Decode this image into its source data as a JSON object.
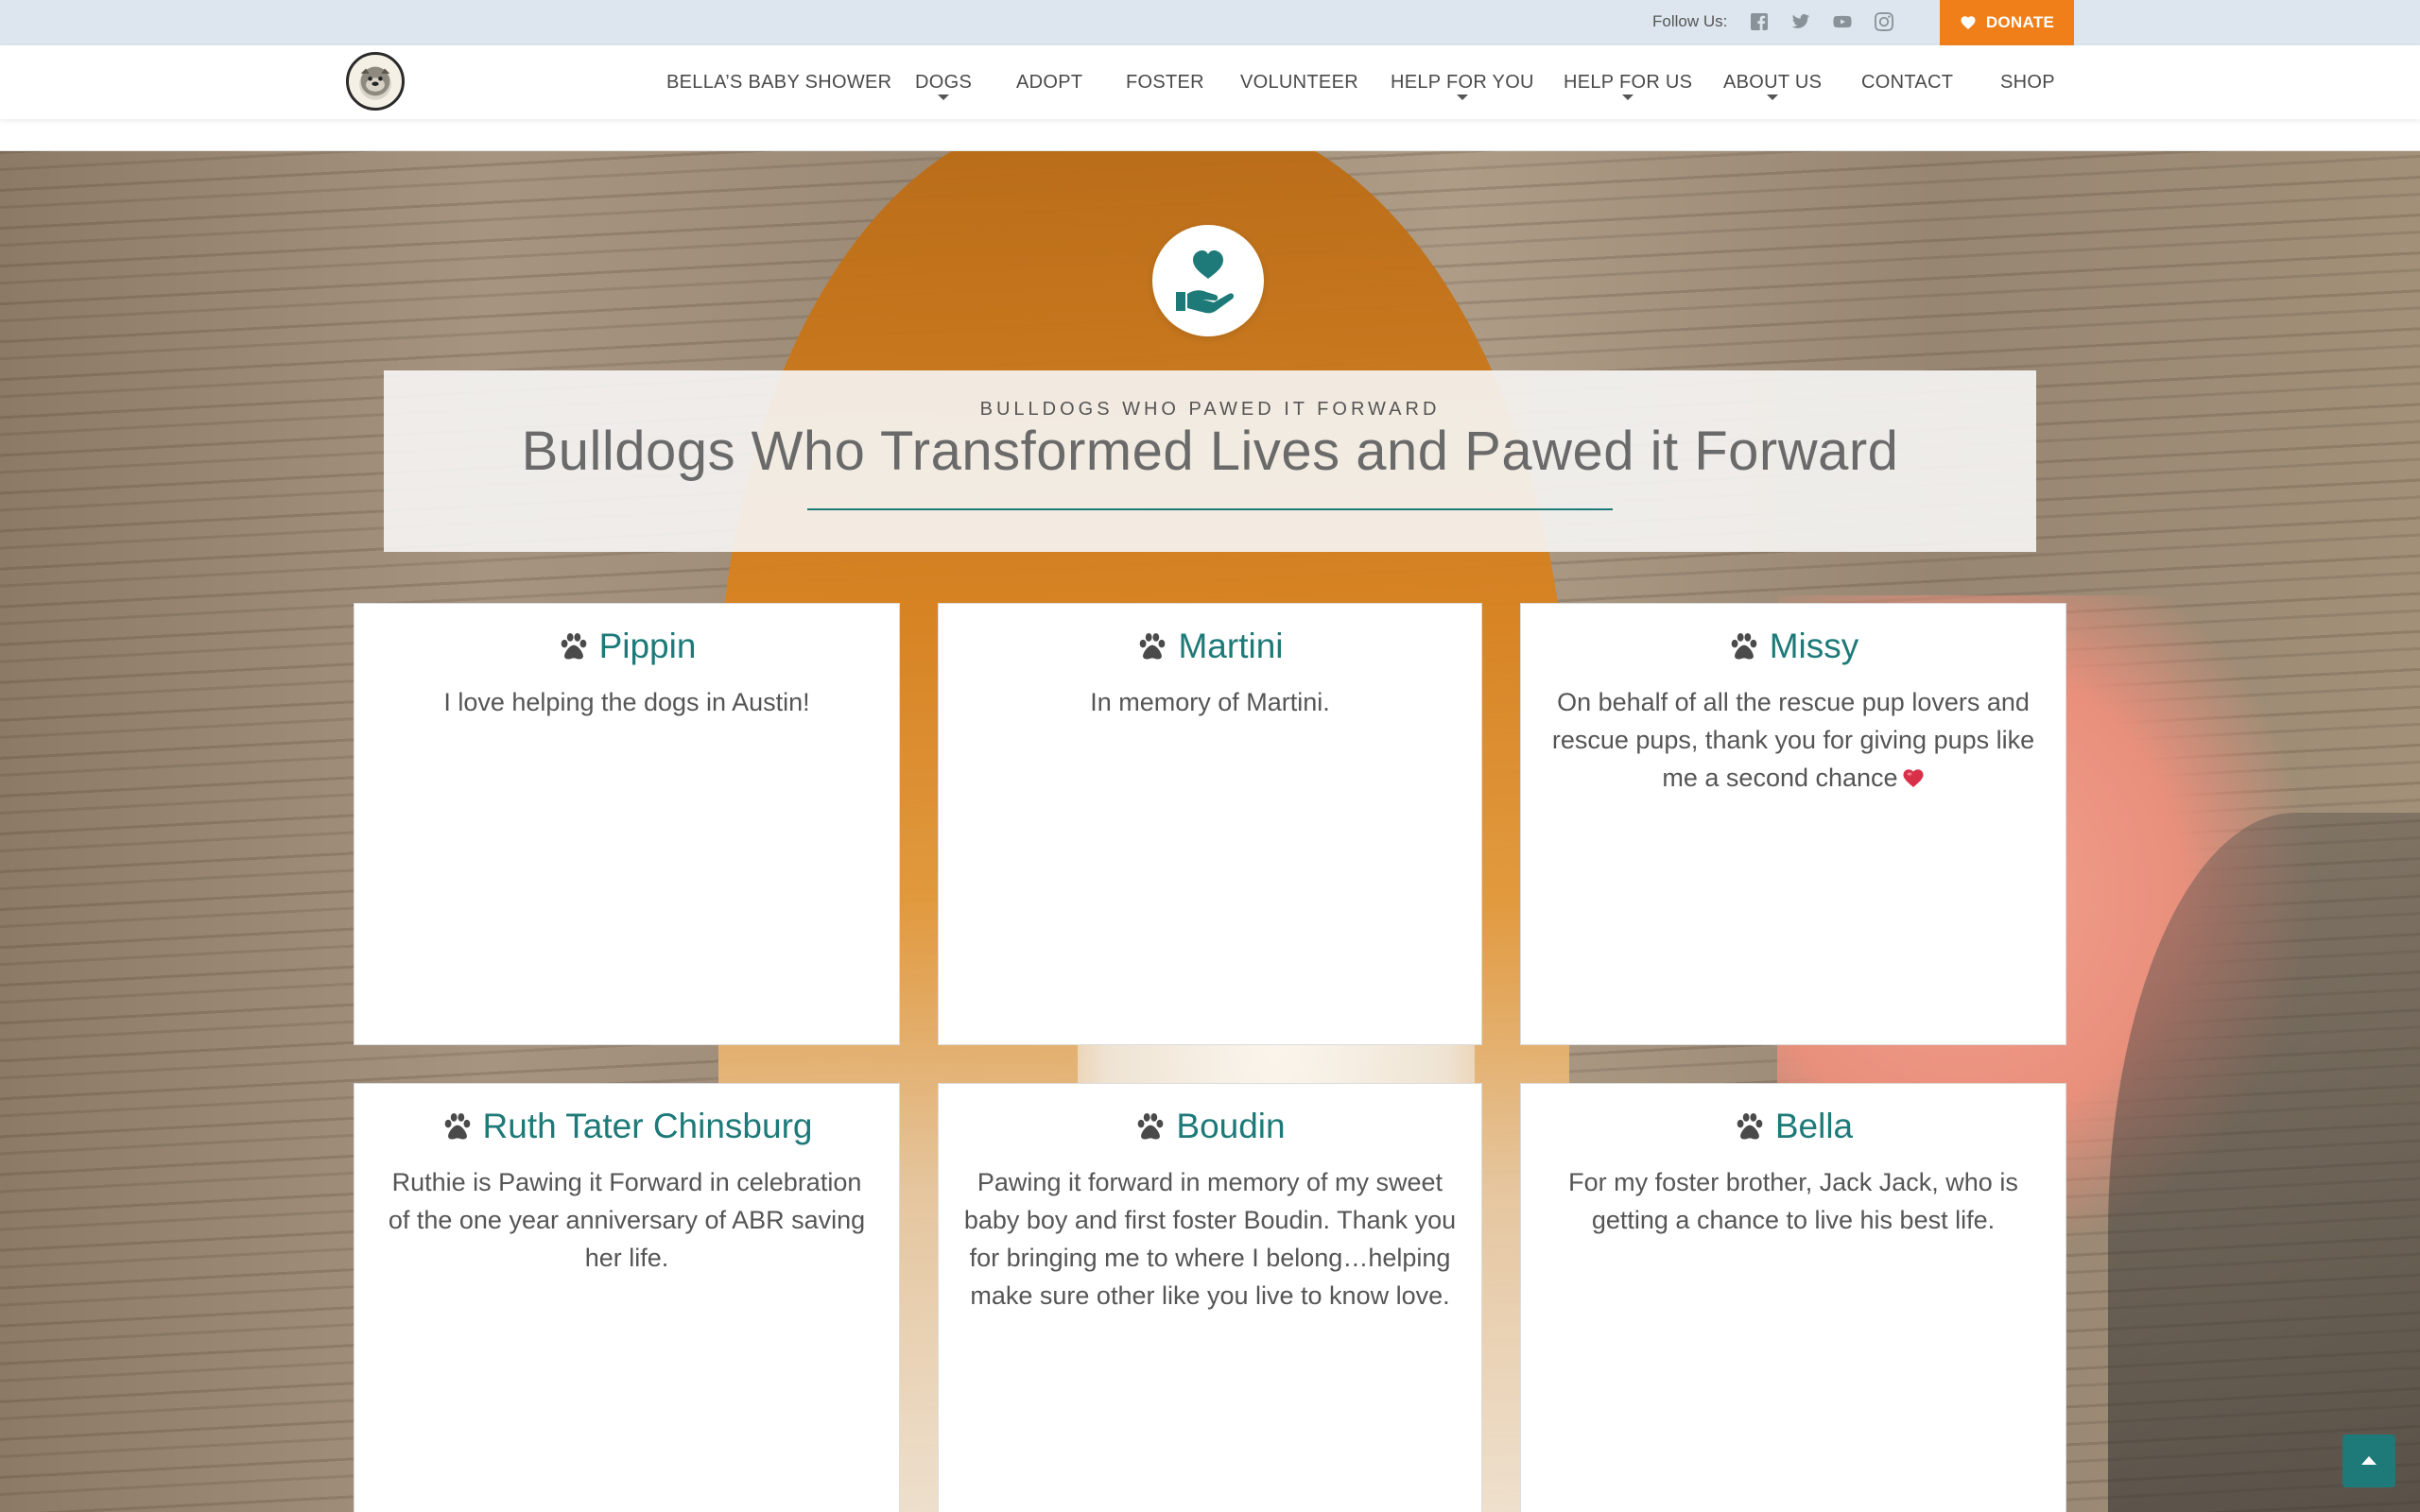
{
  "topbar": {
    "follow_label": "Follow Us:",
    "social_icons": [
      "facebook-icon",
      "twitter-icon",
      "youtube-icon",
      "instagram-icon"
    ],
    "donate_label": "DONATE",
    "donate_color": "#f07f1a"
  },
  "nav": {
    "items": [
      {
        "label": "BELLA’S BABY SHOWER"
      },
      {
        "label": "DOGS",
        "dropdown": true
      },
      {
        "label": "ADOPT"
      },
      {
        "label": "FOSTER"
      },
      {
        "label": "VOLUNTEER"
      },
      {
        "label": "HELP FOR YOU",
        "dropdown": true
      },
      {
        "label": "HELP FOR US",
        "dropdown": true
      },
      {
        "label": "ABOUT US",
        "dropdown": true
      },
      {
        "label": "CONTACT"
      },
      {
        "label": "SHOP"
      }
    ]
  },
  "hero": {
    "kicker": "BULLDOGS WHO PAWED IT FORWARD",
    "title": "Bulldogs Who Transformed Lives and Pawed it Forward",
    "accent_color": "#1d7a78"
  },
  "cards": [
    {
      "name": "Pippin",
      "text": "I love helping the dogs in Austin!"
    },
    {
      "name": "Martini",
      "text": "In memory of Martini."
    },
    {
      "name": "Missy",
      "text": "On behalf of all the rescue pup lovers and rescue pups, thank you for giving pups like me a second chance",
      "emoji": "heart"
    },
    {
      "name": "Ruth Tater Chinsburg",
      "text": "Ruthie is Pawing it Forward in celebration of the one year anniversary of ABR saving her life."
    },
    {
      "name": "Boudin",
      "text": "Pawing it forward in memory of my sweet baby boy and first foster Boudin. Thank you for bringing me to where I belong…helping make sure other like you live to know love."
    },
    {
      "name": "Bella",
      "text": "For my foster brother, Jack Jack, who is getting a chance to live his best life."
    }
  ]
}
